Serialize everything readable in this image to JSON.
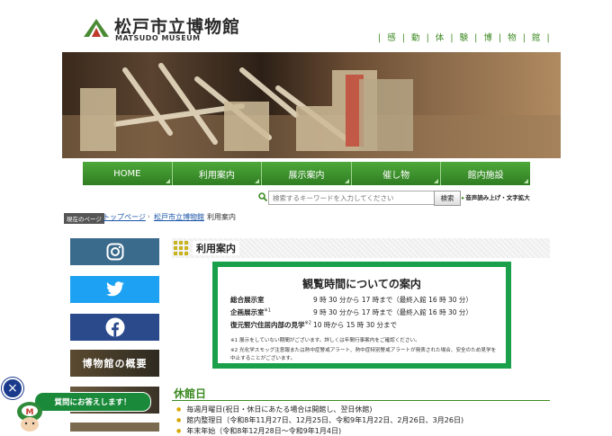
{
  "header": {
    "logo_text": "松戸市立博物館",
    "logo_subtext": "MATSUDO MUSEUM",
    "motto": [
      "感",
      "動",
      "体",
      "験",
      "博",
      "物",
      "館"
    ],
    "motto_sep": "|"
  },
  "nav": {
    "items": [
      "HOME",
      "利用案内",
      "展示案内",
      "催し物",
      "館内施設"
    ]
  },
  "search": {
    "placeholder": "検索するキーワードを入力してください",
    "button_label": "検索",
    "tts_label": "音声読み上げ・文字拡大"
  },
  "breadcrumb": {
    "label": "現在のページ",
    "items": [
      "トップページ",
      "松戸市立博物館",
      "利用案内"
    ],
    "separator": "›"
  },
  "sidebar": {
    "banners": [
      "博物館の概要"
    ]
  },
  "main": {
    "section_title": "利用案内",
    "hours": {
      "title": "観覧時間についての案内",
      "rows": [
        {
          "label": "総合展示室",
          "note": "",
          "value": "9 時 30 分から 17 時まで（最終入館 16 時 30 分）"
        },
        {
          "label": "企画展示室",
          "note": "※1",
          "value": "9 時 30 分から 17 時まで（最終入館 16 時 30 分）"
        },
        {
          "label": "復元竪穴住居内部の見学",
          "note": "※2",
          "value": "10 時から 15 時 30 分まで"
        }
      ],
      "notes": [
        "※1 展示をしていない期間がございます。詳しくは年間行事案内をご確認ください。",
        "※2 光化学スモッグ注意報または熱中症警戒アラート、熱中症特別警戒アラートが発表された場合、安全のため見学を",
        "中止することがございます。"
      ]
    },
    "closed": {
      "title": "休館日",
      "items": [
        "毎週月曜日(祝日・休日にあたる場合は開館し、翌日休館)",
        "館内整理日（令和8年11月27日、12月25日、令和9年1月22日、2月26日、3月26日)",
        "年末年始（令和8年12月28日～令和9年1月4日)"
      ]
    }
  },
  "chat": {
    "bubble_text": "質問にお答えします！",
    "close_label": "×",
    "avatar_letter": "M"
  },
  "colors": {
    "brand_green": "#3c8a22",
    "box_green": "#1aa04a",
    "link_blue": "#1a55a8"
  }
}
